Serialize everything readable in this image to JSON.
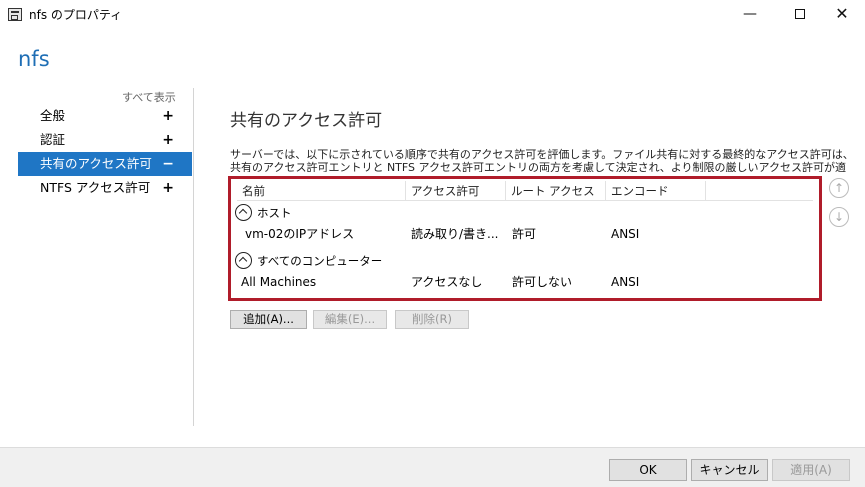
{
  "window": {
    "title": "nfs のプロパティ",
    "minimize": "—",
    "close": "✕"
  },
  "page_name": "nfs",
  "nav": {
    "show_all": "すべて表示",
    "items": [
      {
        "label": "全般",
        "sign": "+"
      },
      {
        "label": "認証",
        "sign": "+"
      },
      {
        "label": "共有のアクセス許可",
        "sign": "−",
        "selected": true
      },
      {
        "label": "NTFS アクセス許可",
        "sign": "+"
      }
    ]
  },
  "section": {
    "title": "共有のアクセス許可",
    "description": "サーバーでは、以下に示されている順序で共有のアクセス許可を評価します。ファイル共有に対する最終的なアクセス許可は、共有のアクセス許可エントリと NTFS アクセス許可エントリの両方を考慮して決定され、より制限の厳しいアクセス許可が適用されます。"
  },
  "table": {
    "columns": [
      "名前",
      "アクセス許可",
      "ルート アクセス",
      "エンコード"
    ],
    "groups": [
      {
        "label": "ホスト",
        "rows": [
          {
            "name": "vm-02のIPアドレス",
            "access": "読み取り/書き...",
            "root": "許可",
            "encoding": "ANSI"
          }
        ]
      },
      {
        "label": "すべてのコンピューター",
        "rows": [
          {
            "name": "All Machines",
            "access": "アクセスなし",
            "root": "許可しない",
            "encoding": "ANSI"
          }
        ]
      }
    ]
  },
  "reorder": {
    "up": "↑",
    "down": "↓"
  },
  "actions": {
    "add": "追加(A)...",
    "edit": "編集(E)...",
    "delete": "削除(R)"
  },
  "footer": {
    "ok": "OK",
    "cancel": "キャンセル",
    "apply": "適用(A)"
  }
}
